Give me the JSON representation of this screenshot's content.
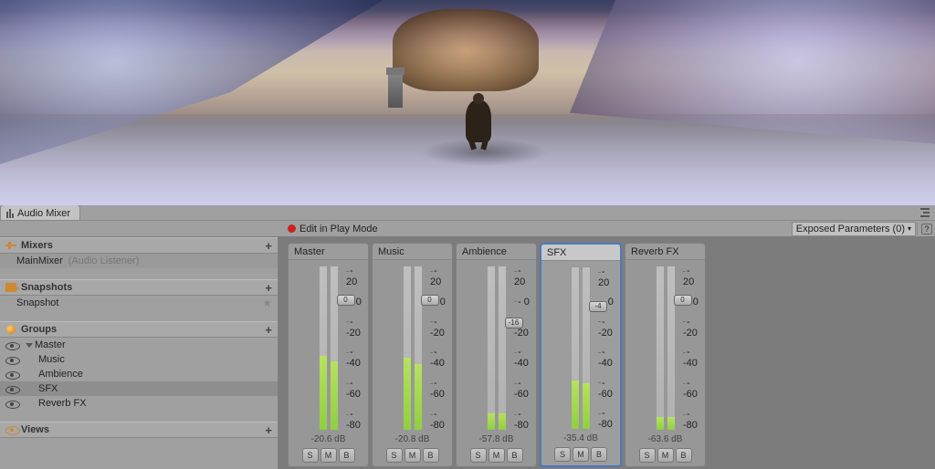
{
  "tab": {
    "label": "Audio Mixer"
  },
  "toolbar": {
    "edit_in_play": "Edit in Play Mode",
    "exposed": "Exposed Parameters (0)"
  },
  "panels": {
    "mixers": {
      "title": "Mixers",
      "items": [
        {
          "name": "MainMixer",
          "note": "(Audio Listener)"
        }
      ]
    },
    "snapshots": {
      "title": "Snapshots",
      "items": [
        "Snapshot"
      ]
    },
    "groups": {
      "title": "Groups",
      "tree": [
        {
          "name": "Master",
          "depth": 0,
          "expandable": true
        },
        {
          "name": "Music",
          "depth": 1
        },
        {
          "name": "Ambience",
          "depth": 1
        },
        {
          "name": "SFX",
          "depth": 1,
          "selected": true
        },
        {
          "name": "Reverb FX",
          "depth": 1
        }
      ]
    },
    "views": {
      "title": "Views"
    }
  },
  "scale_labels": [
    "20",
    "0",
    "-20",
    "-40",
    "-60",
    "-80"
  ],
  "smb": {
    "s": "S",
    "m": "M",
    "b": "B"
  },
  "strips": [
    {
      "name": "Master",
      "db": "-20.6 dB",
      "fader": 0,
      "meterL": 45,
      "meterR": 42,
      "selected": false
    },
    {
      "name": "Music",
      "db": "-20.8 dB",
      "fader": 0,
      "meterL": 44,
      "meterR": 40,
      "selected": false
    },
    {
      "name": "Ambience",
      "db": "-57.8 dB",
      "fader": -16,
      "meterL": 10,
      "meterR": 10,
      "selected": false
    },
    {
      "name": "SFX",
      "db": "-35.4 dB",
      "fader": -4,
      "meterL": 30,
      "meterR": 28,
      "selected": true
    },
    {
      "name": "Reverb FX",
      "db": "-63.6 dB",
      "fader": 0,
      "meterL": 8,
      "meterR": 8,
      "selected": false
    }
  ]
}
